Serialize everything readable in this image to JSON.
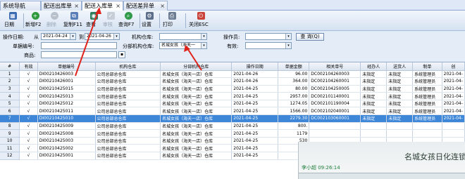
{
  "tabs": [
    {
      "label": "系统导航",
      "closable": false
    },
    {
      "label": "配送出库单",
      "closable": true
    },
    {
      "label": "配送入库单",
      "closable": true,
      "active": true
    },
    {
      "label": "配送差异单",
      "closable": true
    }
  ],
  "toolbar": {
    "buttons": [
      {
        "label": "日期",
        "icon": "calendar-icon",
        "enabled": true
      },
      {
        "label": "新增F2",
        "icon": "add-icon",
        "enabled": true
      },
      {
        "label": "删除",
        "icon": "delete-icon",
        "enabled": false
      },
      {
        "label": "复制F11",
        "icon": "copy-icon",
        "enabled": true
      },
      {
        "label": "查看",
        "icon": "view-icon",
        "enabled": true
      },
      {
        "label": "审核",
        "icon": "audit-icon",
        "enabled": false
      },
      {
        "label": "查询F7",
        "icon": "search-icon",
        "enabled": true
      },
      {
        "label": "设置",
        "icon": "settings-icon",
        "enabled": true
      },
      {
        "label": "打印",
        "icon": "print-icon",
        "enabled": true
      },
      {
        "label": "关闭ESC",
        "icon": "close-icon",
        "enabled": true
      }
    ]
  },
  "filter": {
    "date_label": "操作日期:",
    "from_label": "从",
    "from_value": "2021-04-24",
    "to_label": "到",
    "to_value": "2021-04-26",
    "warehouse_label": "机构仓库:",
    "warehouse_value": "",
    "operator_label": "操作员:",
    "operator_value": "",
    "query_button": "查 询(Q)",
    "docno_label": "单据编号:",
    "docno_value": "",
    "branch_label": "分部机构仓库:",
    "branch_value": "名城女孩（海天一",
    "valid_label": "有效:",
    "valid_value": "",
    "goods_label": "商品:",
    "goods_value": ""
  },
  "table": {
    "columns": [
      "#",
      "有效",
      "单据编号",
      "机构仓库",
      "分部机构仓库",
      "操作日期",
      "单据金额",
      "相关单号",
      "经办人",
      "送货人",
      "制单",
      "创"
    ],
    "rows": [
      [
        "1",
        "√",
        "DI00210426003",
        "公司总部总仓库",
        "名城女孩（海天一店）仓库",
        "2021-04-26",
        "96.00",
        "DC002104260003",
        "未指定",
        "未指定",
        "系统管理员",
        "2021-04-"
      ],
      [
        "2",
        "√",
        "DI00210426001",
        "公司总部总仓库",
        "名城女孩（海天一店）仓库",
        "2021-04-26",
        "364.00",
        "DC002104260001",
        "未指定",
        "未指定",
        "系统管理员",
        "2021-04-"
      ],
      [
        "3",
        "√",
        "DI00210425015",
        "公司总部总仓库",
        "名城女孩（海天一店）仓库",
        "2021-04-25",
        "80.00",
        "DC002104250005",
        "未指定",
        "未指定",
        "系统管理员",
        "2021-04-"
      ],
      [
        "4",
        "√",
        "DI00210425013",
        "公司总部总仓库",
        "名城女孩（海天一店）仓库",
        "2021-04-25",
        "2957.00",
        "DC002101140001",
        "未指定",
        "未指定",
        "系统管理员",
        "2021-04-"
      ],
      [
        "5",
        "√",
        "DI00210425012",
        "公司总部总仓库",
        "名城女孩（海天一店）仓库",
        "2021-04-25",
        "1274.05",
        "DC002101190004",
        "未指定",
        "未指定",
        "系统管理员",
        "2021-04-"
      ],
      [
        "6",
        "√",
        "DI00210425011",
        "公司总部总仓库",
        "名城女孩（海天一店）仓库",
        "2021-04-25",
        "1566.00",
        "DC002102040001",
        "未指定",
        "未指定",
        "系统管理员",
        "2021-04-"
      ],
      [
        "7",
        "√",
        "DI00210425010",
        "公司总部总仓库",
        "名城女孩（海天一店）仓库",
        "2021-04-25",
        "2279.30",
        "DC002103060001",
        "未指定",
        "未指定",
        "系统管理员",
        "2021-04-"
      ],
      [
        "8",
        "√",
        "DI00210425009",
        "公司总部总仓库",
        "名城女孩（海天一店）仓库",
        "2021-04-25",
        "800.",
        "",
        "",
        "",
        "",
        ""
      ],
      [
        "9",
        "√",
        "DI00210425008",
        "公司总部总仓库",
        "名城女孩（海天一店）仓库",
        "2021-04-25",
        "1179",
        "",
        "",
        "",
        "",
        ""
      ],
      [
        "10",
        "√",
        "DI00210425003",
        "公司总部总仓库",
        "名城女孩（海天一店）仓库",
        "2021-04-25",
        "530",
        "",
        "",
        "",
        "",
        ""
      ],
      [
        "11",
        "√",
        "DI00210425002",
        "公司总部总仓库",
        "名城女孩（海天一店）仓库",
        "2021-04-25",
        "943",
        "",
        "",
        "",
        "",
        ""
      ],
      [
        "12",
        "√",
        "DI00210425001",
        "公司总部总仓库",
        "名城女孩（海天一店）仓库",
        "2021-04-25",
        "248",
        "",
        "",
        "",
        "",
        ""
      ]
    ],
    "selected_row": 6
  },
  "overlay": {
    "sign_text": "名城女孩日化连锁",
    "person_text": "李小超  09:26:14"
  },
  "colors": {
    "selection": "#3d86d8",
    "annotation_arrow": "#e0231b"
  }
}
